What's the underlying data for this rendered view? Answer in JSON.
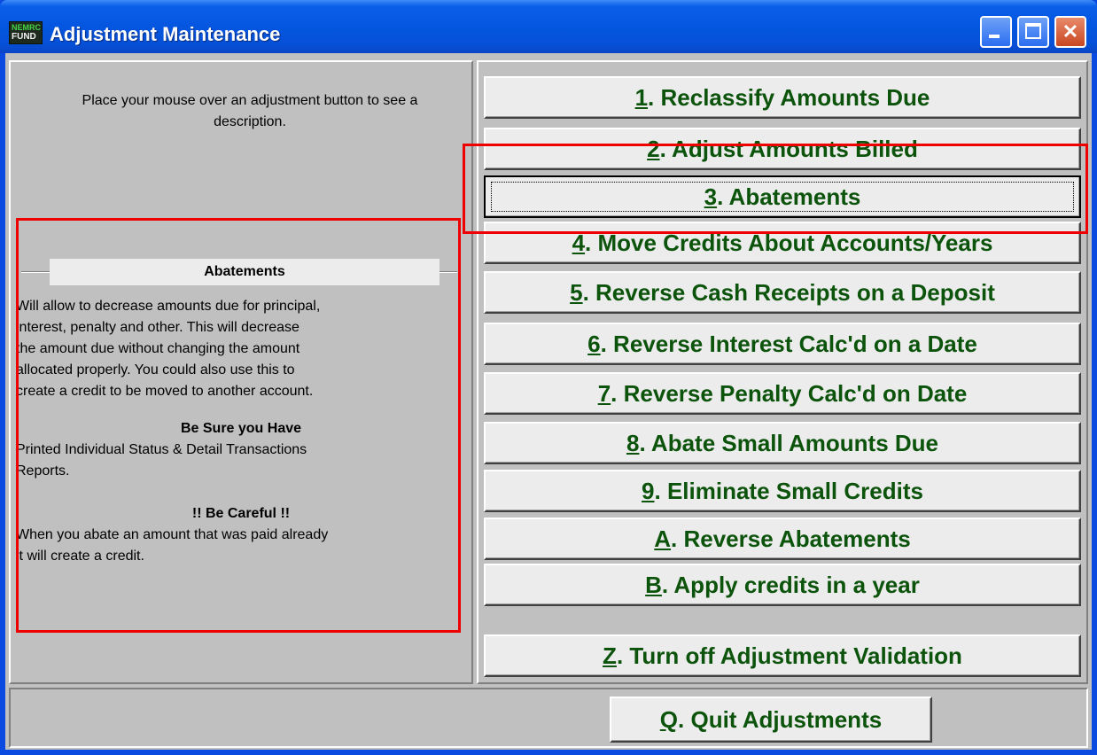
{
  "window": {
    "title": "Adjustment Maintenance",
    "icon_top": "NEMRC",
    "icon_bottom": "FUND",
    "controls": {
      "minimize": "minimize-icon",
      "maximize": "maximize-icon",
      "close": "close-icon"
    }
  },
  "left_panel": {
    "hint": "Place your mouse over an adjustment button to see a description.",
    "description": {
      "title": "Abatements",
      "body_lines": [
        "Will allow to decrease amounts due for principal,",
        "interest, penalty and other. This will decrease",
        "the amount due without changing the amount",
        "allocated properly. You could also use this to",
        "create a credit to be moved to another account."
      ],
      "be_sure_heading": "Be Sure you Have",
      "be_sure_lines": [
        "Printed Individual Status & Detail Transactions",
        "Reports."
      ],
      "careful_heading": "!! Be Careful !!",
      "careful_lines": [
        "When you abate an amount that was paid already",
        "it will create a credit."
      ]
    }
  },
  "buttons": [
    {
      "key": "1",
      "label": ".  Reclassify Amounts Due"
    },
    {
      "key": "2",
      "label": ". Adjust Amounts Billed"
    },
    {
      "key": "3",
      "label": ". Abatements"
    },
    {
      "key": "4",
      "label": ". Move Credits About Accounts/Years"
    },
    {
      "key": "5",
      "label": ". Reverse Cash Receipts on a Deposit"
    },
    {
      "key": "6",
      "label": ". Reverse Interest Calc'd on a Date"
    },
    {
      "key": "7",
      "label": ". Reverse Penalty Calc'd on Date"
    },
    {
      "key": "8",
      "label": ". Abate Small Amounts Due"
    },
    {
      "key": "9",
      "label": ". Eliminate Small Credits"
    },
    {
      "key": "A",
      "label": ". Reverse Abatements"
    },
    {
      "key": "B",
      "label": ". Apply credits in a year"
    },
    {
      "key": "Z",
      "label": ". Turn off Adjustment Validation"
    }
  ],
  "quit_button": {
    "key": "Q",
    "label": ".  Quit Adjustments"
  },
  "colors": {
    "button_text": "#0c530c",
    "highlight": "#ee0000",
    "title_bar": "#0456e0"
  }
}
